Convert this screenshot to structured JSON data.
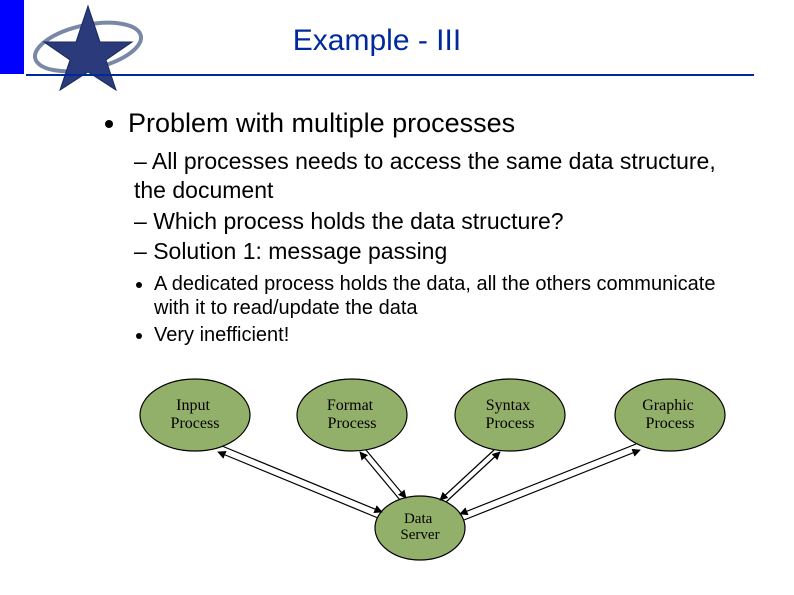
{
  "title": "Example - III",
  "bullets": {
    "main": "Problem with multiple processes",
    "sub1": "All processes needs to access the same data structure, the document",
    "sub2": "Which process holds the data structure?",
    "sub3": "Solution 1: message passing",
    "subsub1": "A dedicated process holds the data, all the others communicate with it to read/update the data",
    "subsub2": "Very inefficient!"
  },
  "diagram": {
    "nodes": {
      "input": {
        "line1": "Input",
        "line2": "Process"
      },
      "format": {
        "line1": "Format",
        "line2": "Process"
      },
      "syntax": {
        "line1": "Syntax",
        "line2": "Process"
      },
      "graphic": {
        "line1": "Graphic",
        "line2": "Process"
      },
      "server": {
        "line1": "Data",
        "line2": "Server"
      }
    },
    "colors": {
      "node_fill": "#93b06a",
      "node_stroke": "#000000"
    }
  }
}
